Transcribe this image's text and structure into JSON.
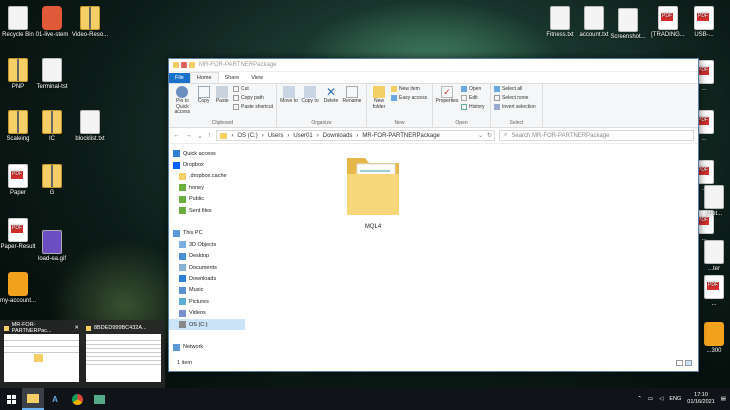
{
  "desktop": {
    "left_icons": [
      {
        "label": "Recycle Bin",
        "type": "txt"
      },
      {
        "label": "01-live-stem",
        "type": "red"
      },
      {
        "label": "Video-Reso...",
        "type": "zip"
      },
      {
        "label": "PNP",
        "type": "zip"
      },
      {
        "label": "Terminal-tst",
        "type": "txt"
      },
      {
        "label": "Scaleing",
        "type": "zip"
      },
      {
        "label": "IC",
        "type": "zip"
      },
      {
        "label": "blocklist.txt",
        "type": "txt"
      },
      {
        "label": "Paper",
        "type": "pdf"
      },
      {
        "label": "G",
        "type": "zip"
      },
      {
        "label": "Paper-Result",
        "type": "pdf"
      },
      {
        "label": "load-ea.gif",
        "type": "gif"
      },
      {
        "label": "my-account...",
        "type": "scorp"
      }
    ],
    "right_icons": [
      {
        "label": "Fitness.txt",
        "type": "txt"
      },
      {
        "label": "account.txt",
        "type": "txt"
      },
      {
        "label": "Screenshot...",
        "type": "txt"
      },
      {
        "label": "[TRADING...",
        "type": "pdf"
      },
      {
        "label": "USB-...",
        "type": "pdf"
      },
      {
        "label": "...",
        "type": "pdf"
      },
      {
        "label": "...",
        "type": "pdf"
      },
      {
        "label": "...",
        "type": "pdf"
      },
      {
        "label": "...",
        "type": "pdf"
      },
      {
        "label": "shot...",
        "type": "txt"
      },
      {
        "label": "...ter",
        "type": "txt"
      },
      {
        "label": "...",
        "type": "pdf"
      },
      {
        "label": "...300",
        "type": "scorp"
      }
    ]
  },
  "window": {
    "title": "MR-FOR-PARTNERPackage",
    "menu_tabs": [
      "File",
      "Home",
      "Share",
      "View"
    ],
    "ribbon": {
      "clipboard": {
        "pin": "Pin to Quick access",
        "copy": "Copy",
        "paste": "Paste",
        "cut": "Cut",
        "copy_path": "Copy path",
        "paste_shortcut": "Paste shortcut",
        "group": "Clipboard"
      },
      "organize": {
        "move_to": "Move to",
        "copy_to": "Copy to",
        "delete": "Delete",
        "rename": "Rename",
        "group": "Organize"
      },
      "new": {
        "new_folder": "New folder",
        "new_item": "New item",
        "easy_access": "Easy access",
        "group": "New"
      },
      "open": {
        "properties": "Properties",
        "open": "Open",
        "edit": "Edit",
        "history": "History",
        "group": "Open"
      },
      "select": {
        "select_all": "Select all",
        "select_none": "Select none",
        "invert": "Invert selection",
        "group": "Select"
      }
    },
    "address": {
      "path": [
        "OS (C:)",
        "Users",
        "User01",
        "Downloads",
        "MR-FOR-PARTNERPackage"
      ],
      "search_placeholder": "Search MR-FOR-PARTNERPackage"
    },
    "nav": [
      {
        "label": "Quick access",
        "icon": "star"
      },
      {
        "label": "Dropbox",
        "icon": "dropbox"
      },
      {
        "label": ".dropbox.cache",
        "icon": "folder"
      },
      {
        "label": "honey",
        "icon": "folder-green"
      },
      {
        "label": "Public",
        "icon": "folder-green"
      },
      {
        "label": "Sent files",
        "icon": "folder-green"
      },
      {
        "label": "",
        "icon": ""
      },
      {
        "label": "This PC",
        "icon": "pc"
      },
      {
        "label": "3D Objects",
        "icon": "cube"
      },
      {
        "label": "Desktop",
        "icon": "desktop"
      },
      {
        "label": "Documents",
        "icon": "docs"
      },
      {
        "label": "Downloads",
        "icon": "down"
      },
      {
        "label": "Music",
        "icon": "music"
      },
      {
        "label": "Pictures",
        "icon": "pics"
      },
      {
        "label": "Videos",
        "icon": "videos"
      },
      {
        "label": "OS (C:)",
        "icon": "drive"
      },
      {
        "label": "",
        "icon": ""
      },
      {
        "label": "Network",
        "icon": "network"
      }
    ],
    "content": {
      "folder_name": "MQL4"
    },
    "status": "1 item"
  },
  "thumbnails": [
    {
      "title": "MR-FOR-PARTNERPac..."
    },
    {
      "title": "8BDED999BC432A..."
    }
  ],
  "taskbar": {
    "lang": "ENG",
    "time": "17:10",
    "date": "01/16/2021"
  },
  "colors": {
    "accent": "#1a73c8",
    "selection": "#cce4f7",
    "folder": "#f3cf66"
  }
}
